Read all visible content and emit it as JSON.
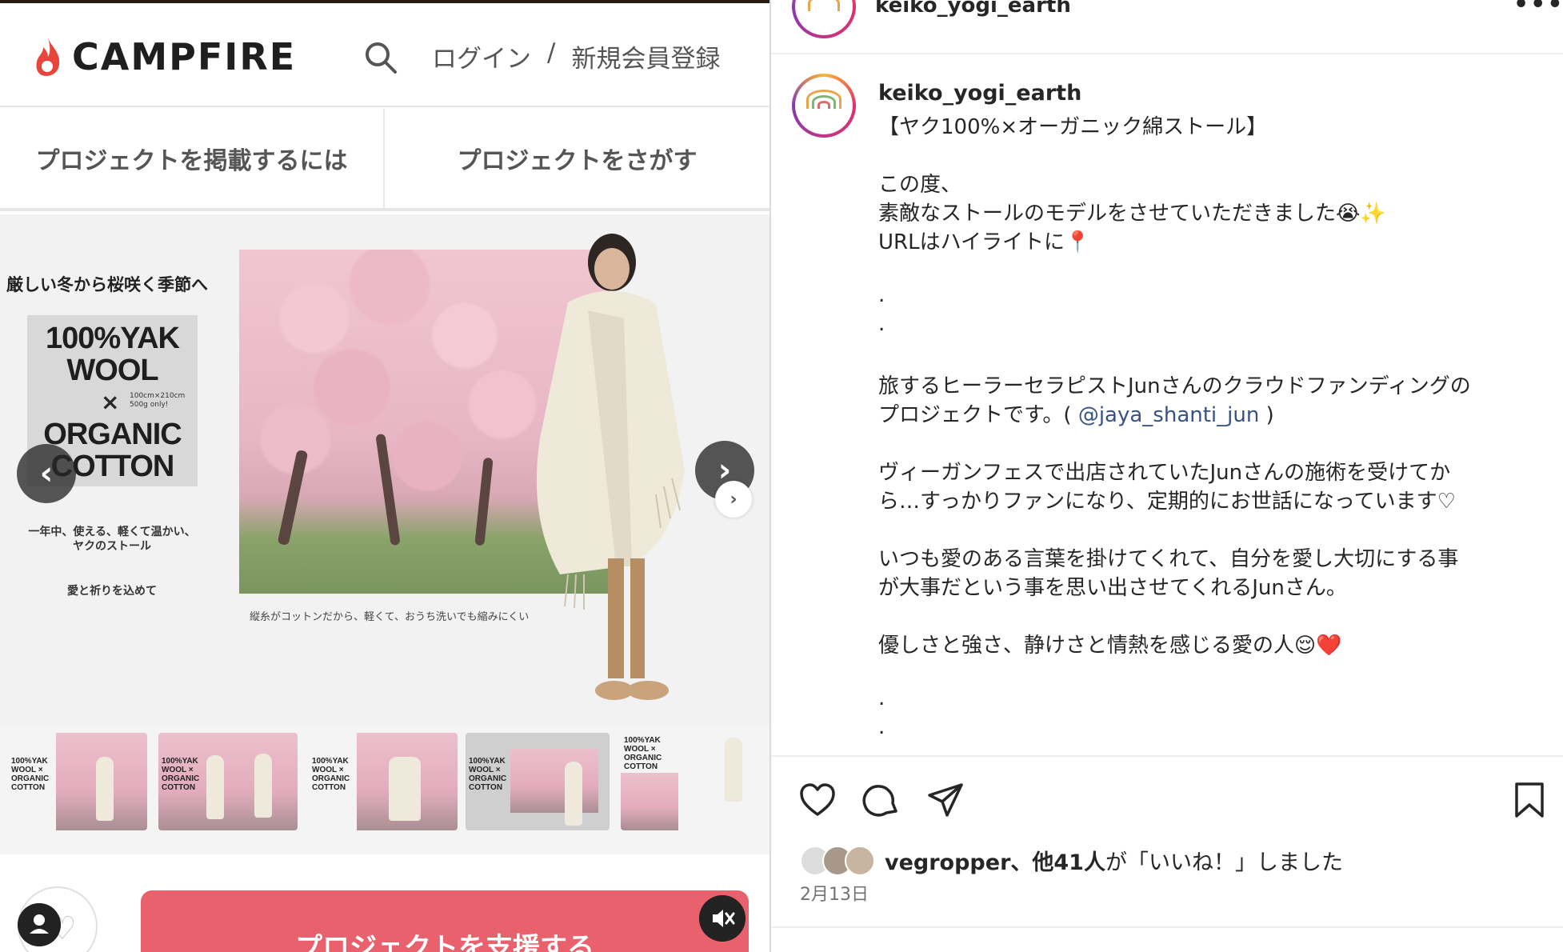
{
  "campfire": {
    "logo_text": "CAMPFIRE",
    "login": "ログイン",
    "separator": "/",
    "signup": "新規会員登録",
    "nav": [
      "プロジェクトを掲載するには",
      "プロジェクトをさがす"
    ],
    "slide": {
      "heading": "厳しい冬から桜咲く季節へ",
      "yak_line1": "100%YAK",
      "yak_line2": "WOOL",
      "yak_x": "×",
      "yak_size": "100cm×210cm\n500g only!",
      "yak_line3": "ORGANIC",
      "yak_line4": "COTTON",
      "sub1": "一年中、使える、軽くて温かい、",
      "sub2": "ヤクのストール",
      "sub3": "愛と祈りを込めて",
      "caption": "縦糸がコットンだから、軽くて、おうち洗いでも縮みにくい"
    },
    "arrow_prev": "‹",
    "arrow_next": "›",
    "thumbnails": [
      {
        "label": "100%YAK WOOL × ORGANIC COTTON"
      },
      {
        "label": "100%YAK WOOL × ORGANIC COTTON"
      },
      {
        "label": "100%YAK WOOL × ORGANIC COTTON"
      },
      {
        "label": "100%YAK WOOL × ORGANIC COTTON"
      },
      {
        "label": "100%YAK WOOL × ORGANIC COTTON"
      }
    ],
    "support_button": "プロジェクトを支援する",
    "colors": {
      "accent": "#e8616c",
      "flame": "#e8453c"
    }
  },
  "instagram": {
    "username_top": "keiko_yogi_earth",
    "more": "•••",
    "caption_user": "keiko_yogi_earth",
    "caption_dot": ".",
    "caption_lines": [
      "【ヤク100%×オーガニック綿ストール】",
      "この度、",
      "素敵なストールのモデルをさせていただきました😭✨",
      "URLはハイライトに📍",
      ".",
      ".",
      "旅するヒーラーセラピストJunさんのクラウドファンディングの",
      "ヴィーガンフェスで出店されていたJunさんの施術を受けてか",
      "ら…すっかりファンになり、定期的にお世話になっています♡",
      "いつも愛のある言葉を掛けてくれて、自分を愛し大切にする事",
      "が大事だという事を思い出させてくれるJunさん。",
      "優しさと強さ、静けさと情熱を感じる愛の人😌❤️",
      ".",
      "."
    ],
    "project_line_prefix": "プロジェクトです。( ",
    "mention": "@jaya_shanti_jun",
    "project_line_suffix": " )",
    "likes_user": "vegropper",
    "likes_others": "、他41人",
    "likes_suffix": "が「いいね！」しました",
    "date": "2月13日",
    "icons": [
      "heart-icon",
      "comment-icon",
      "share-icon",
      "bookmark-icon"
    ]
  }
}
